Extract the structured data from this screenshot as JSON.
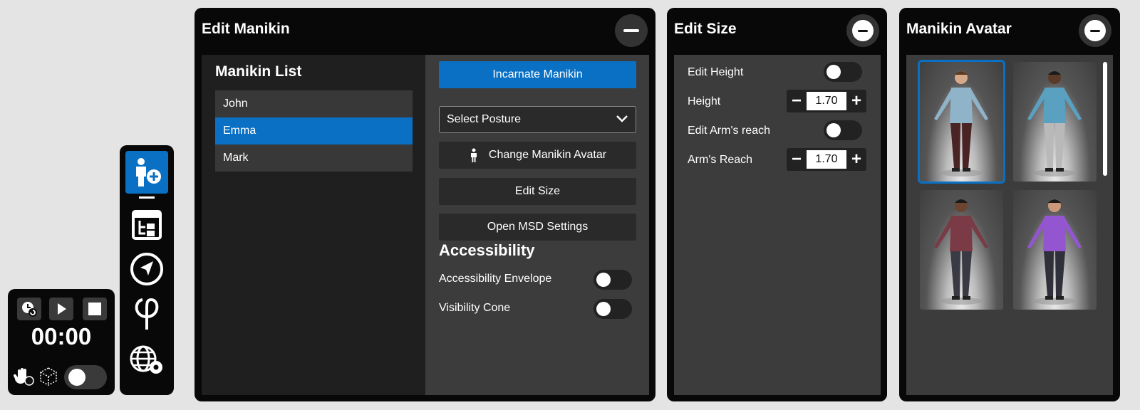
{
  "timer": {
    "time": "00:00"
  },
  "edit_manikin": {
    "title": "Edit Manikin",
    "list_title": "Manikin List",
    "manikins": [
      "John",
      "Emma",
      "Mark"
    ],
    "selected_manikin": "Emma",
    "incarnate_label": "Incarnate Manikin",
    "posture_select": "Select Posture",
    "change_avatar_label": "Change Manikin Avatar",
    "edit_size_label": "Edit Size",
    "msd_label": "Open MSD Settings",
    "accessibility_title": "Accessibility",
    "accessibility_envelope_label": "Accessibility Envelope",
    "visibility_cone_label": "Visibility Cone"
  },
  "edit_size": {
    "title": "Edit Size",
    "edit_height_label": "Edit Height",
    "height_label": "Height",
    "height_value": "1.70",
    "edit_arm_label": "Edit Arm's reach",
    "arm_label": "Arm's Reach",
    "arm_value": "1.70"
  },
  "avatar_panel": {
    "title": "Manikin Avatar",
    "avatars": [
      {
        "shirt": "#8fb3c9",
        "pants": "#4a2424",
        "skin": "#d6a98a",
        "hair": "#5a3a22"
      },
      {
        "shirt": "#5aa0c0",
        "pants": "#b9b9b9",
        "skin": "#5a3b28",
        "hair": "#1b1b1b"
      },
      {
        "shirt": "#7a3b46",
        "pants": "#3a3a44",
        "skin": "#6b4530",
        "hair": "#1b1b1b"
      },
      {
        "shirt": "#9456d0",
        "pants": "#30303a",
        "skin": "#c9997a",
        "hair": "#1b1b1b"
      }
    ]
  },
  "colors": {
    "accent": "#0a70c4",
    "panel": "#080808",
    "surface": "#3c3c3c"
  }
}
